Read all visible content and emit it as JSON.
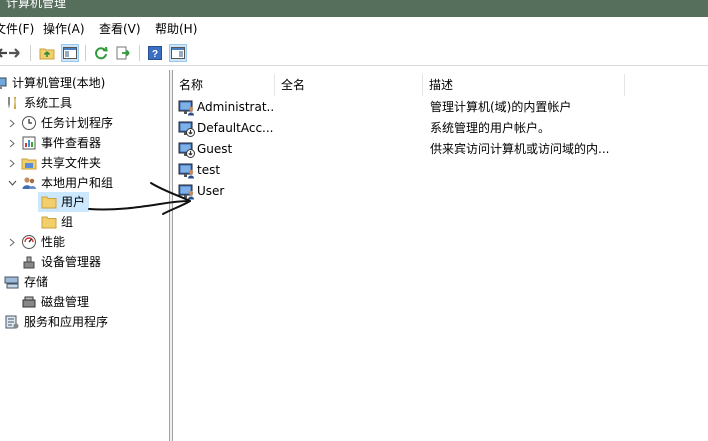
{
  "window": {
    "title": "计算机管理"
  },
  "menu": {
    "items": [
      {
        "label": "文件(F)"
      },
      {
        "label": "操作(A)"
      },
      {
        "label": "查看(V)"
      },
      {
        "label": "帮助(H)"
      }
    ]
  },
  "tree": {
    "root": "计算机管理(本地)",
    "system_tools": "系统工具",
    "task_scheduler": "任务计划程序",
    "event_viewer": "事件查看器",
    "shared_folders": "共享文件夹",
    "local_users_groups": "本地用户和组",
    "users": "用户",
    "groups": "组",
    "performance": "性能",
    "device_manager": "设备管理器",
    "storage": "存储",
    "disk_management": "磁盘管理",
    "services_apps": "服务和应用程序"
  },
  "list": {
    "columns": {
      "name": "名称",
      "fullname": "全名",
      "description": "描述"
    },
    "rows": [
      {
        "name": "Administrat...",
        "fullname": "",
        "description": "管理计算机(域)的内置帐户"
      },
      {
        "name": "DefaultAcc...",
        "fullname": "",
        "description": "系统管理的用户帐户。"
      },
      {
        "name": "Guest",
        "fullname": "",
        "description": "供来宾访问计算机或访问域的内..."
      },
      {
        "name": "test",
        "fullname": "",
        "description": ""
      },
      {
        "name": "User",
        "fullname": "",
        "description": ""
      }
    ]
  },
  "colors": {
    "titlebar": "#566e5c",
    "selection": "#cce8ff",
    "folder": "#f3cf6b"
  }
}
